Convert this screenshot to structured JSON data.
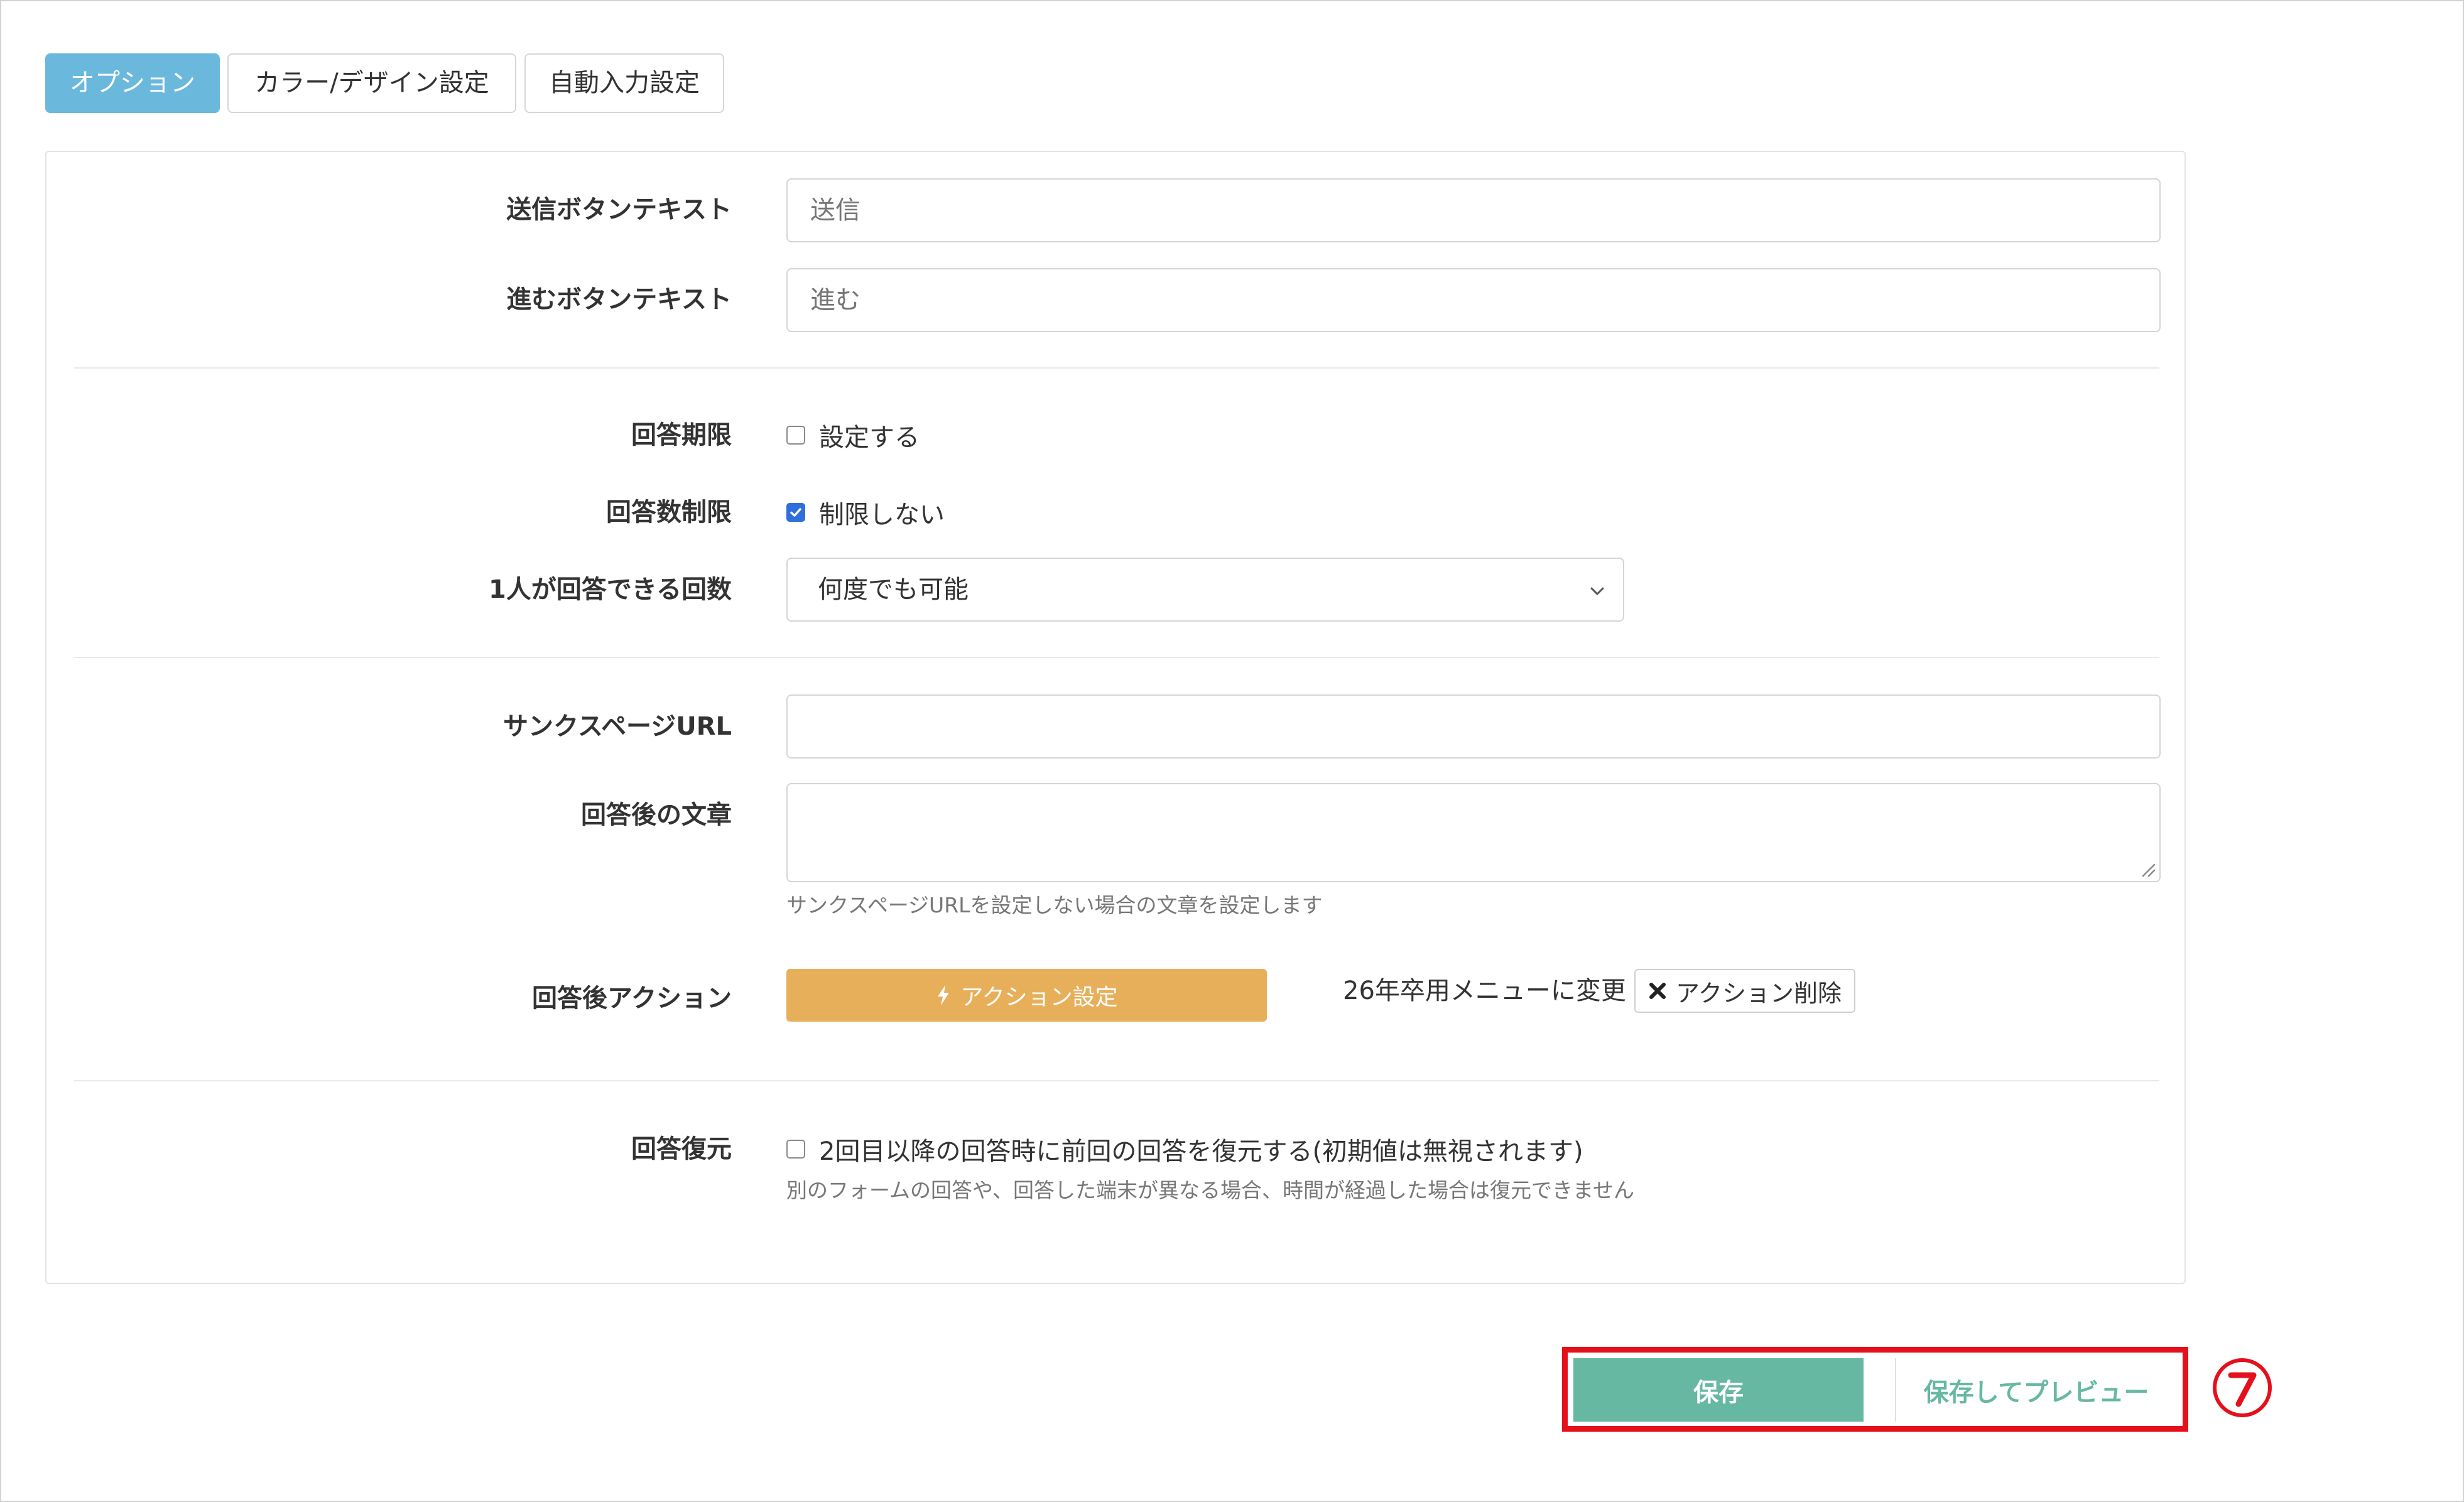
{
  "tabs": [
    {
      "label": "オプション",
      "active": true
    },
    {
      "label": "カラー/デザイン設定",
      "active": false
    },
    {
      "label": "自動入力設定",
      "active": false
    }
  ],
  "form": {
    "submit_text": {
      "label": "送信ボタンテキスト",
      "placeholder": "送信"
    },
    "next_text": {
      "label": "進むボタンテキスト",
      "placeholder": "進む"
    },
    "deadline": {
      "label": "回答期限",
      "checkbox_label": "設定する",
      "checked": false
    },
    "limit": {
      "label": "回答数制限",
      "checkbox_label": "制限しない",
      "checked": true
    },
    "per_person": {
      "label": "1人が回答できる回数",
      "selected": "何度でも可能"
    },
    "thanks_url": {
      "label": "サンクスページURL",
      "value": ""
    },
    "after_text": {
      "label": "回答後の文章",
      "value": "",
      "help": "サンクスページURLを設定しない場合の文章を設定します"
    },
    "after_action": {
      "label": "回答後アクション",
      "button_label": "アクション設定",
      "menu_text": "26年卒用メニューに変更",
      "delete_label": "アクション削除"
    },
    "restore": {
      "label": "回答復元",
      "checkbox_label": "2回目以降の回答時に前回の回答を復元する(初期値は無視されます)",
      "checked": false,
      "help": "別のフォームの回答や、回答した端末が異なる場合、時間が経過した場合は復元できません"
    }
  },
  "footer": {
    "save_label": "保存",
    "preview_label": "保存してプレビュー",
    "step_marker": "⑦"
  },
  "colors": {
    "tab_active": "#6ab9dc",
    "action_button": "#e8af5a",
    "save_button": "#66b8a2",
    "checkbox_checked": "#2f6fdc",
    "highlight": "#e5101c"
  }
}
